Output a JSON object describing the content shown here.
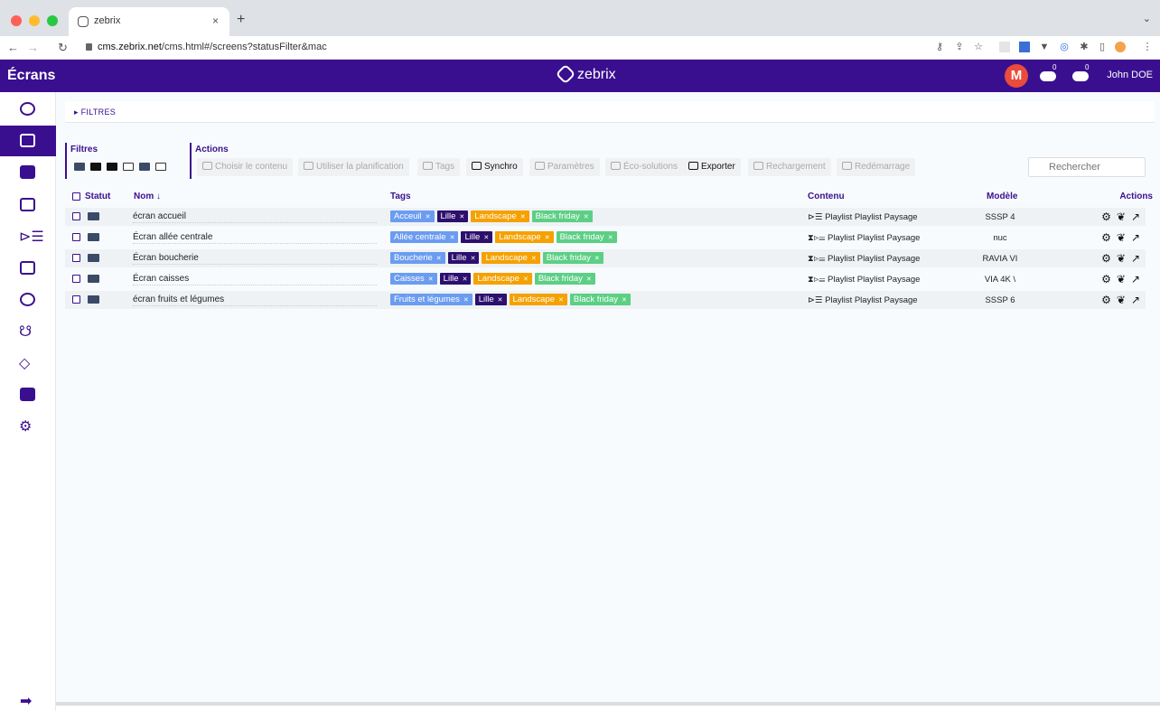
{
  "browser": {
    "tab_title": "zebrix",
    "tab_close": "×",
    "new_tab": "+",
    "tab_menu": "⌄",
    "url_domain": "cms.zebrix.net",
    "url_path": "/cms.html#/screens?statusFilter&mac"
  },
  "header": {
    "page_title": "Écrans",
    "brand": "zebrix",
    "avatar_letter": "M",
    "cloud_badge_1": "0",
    "cloud_badge_2": "0",
    "user_name": "John DOE"
  },
  "sidebar": {
    "items": [
      "dashboard-icon",
      "screens-icon",
      "media-icon",
      "folder-icon",
      "playlist-icon",
      "calendar-icon",
      "database-icon",
      "groups-icon",
      "tag-icon",
      "news-icon",
      "settings-icon"
    ],
    "active": "screens-icon",
    "logout_icon": "logout-icon"
  },
  "filters_bar": {
    "label": "▸ FILTRES"
  },
  "toolbar": {
    "filtres_title": "Filtres",
    "actions_title": "Actions",
    "actions": [
      {
        "label": "Choisir le contenu",
        "enabled": false
      },
      {
        "label": "Utiliser la planification",
        "enabled": false
      },
      {
        "label": "Tags",
        "enabled": false
      },
      {
        "label": "Synchro",
        "enabled": true
      },
      {
        "label": "Paramètres",
        "enabled": false
      },
      {
        "label": "Éco-solutions",
        "enabled": false
      },
      {
        "label": "Exporter",
        "enabled": true
      },
      {
        "label": "Rechargement",
        "enabled": false
      },
      {
        "label": "Redémarrage",
        "enabled": false
      }
    ],
    "search_placeholder": "Rechercher"
  },
  "table": {
    "headers": {
      "statut": "Statut",
      "nom": "Nom ↓",
      "tags": "Tags",
      "contenu": "Contenu",
      "modele": "Modèle",
      "actions": "Actions"
    },
    "rows": [
      {
        "name": "écran accueil",
        "tags": [
          "Acceuil",
          "Lille",
          "Landscape",
          "Black friday"
        ],
        "contenu": "⊳☰ Playlist Playlist Paysage",
        "modele": "SSSP 4"
      },
      {
        "name": "Écran allée centrale",
        "tags": [
          "Allée centrale",
          "Lille",
          "Landscape",
          "Black friday"
        ],
        "contenu": "⧗⊳☰ Playlist Playlist Paysage",
        "modele": "nuc"
      },
      {
        "name": "Écran boucherie",
        "tags": [
          "Boucherie",
          "Lille",
          "Landscape",
          "Black friday"
        ],
        "contenu": "⧗⊳☰ Playlist Playlist Paysage",
        "modele": "RAVIA VI"
      },
      {
        "name": "Écran caisses",
        "tags": [
          "Caisses",
          "Lille",
          "Landscape",
          "Black friday"
        ],
        "contenu": "⧗⊳☰ Playlist Playlist Paysage",
        "modele": "VIA 4K \\"
      },
      {
        "name": "écran fruits et légumes",
        "tags": [
          "Fruits et légumes",
          "Lille",
          "Landscape",
          "Black friday"
        ],
        "contenu": "⊳☰ Playlist Playlist Paysage",
        "modele": "SSSP 6"
      }
    ],
    "tag_colors": [
      "#6b9cf0",
      "#2c0f6e",
      "#f5a100",
      "#5ccf85"
    ],
    "action_icons": [
      "⚙",
      "❦",
      "↗"
    ]
  },
  "colors": {
    "primary": "#3a0f8f",
    "avatar": "#e94b3c"
  }
}
